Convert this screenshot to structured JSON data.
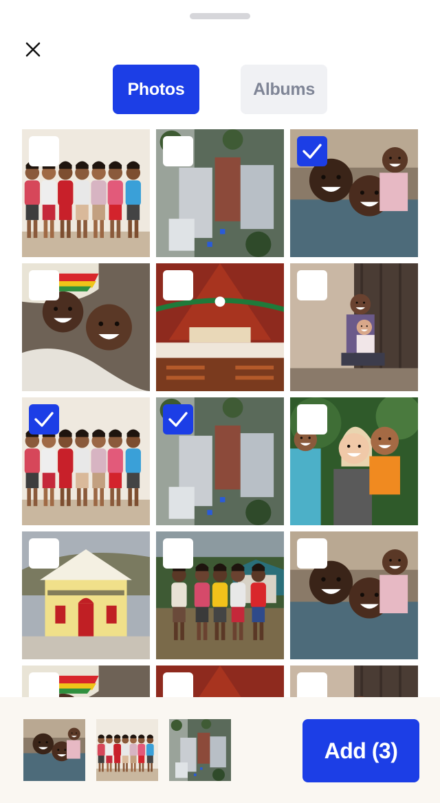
{
  "tabs": [
    {
      "label": "Photos",
      "active": true
    },
    {
      "label": "Albums",
      "active": false
    }
  ],
  "colors": {
    "accent": "#1c3ee6",
    "inactive_tab_bg": "#f0f1f4",
    "inactive_tab_text": "#7f8596",
    "bottom_bar_bg": "#faf7f2"
  },
  "icons": {
    "close": "close-icon",
    "check": "checkmark-icon"
  },
  "grid": {
    "photos": [
      {
        "scene": "children-wall",
        "selected": false
      },
      {
        "scene": "aerial-rooftops",
        "selected": false
      },
      {
        "scene": "kids-smiling",
        "selected": true
      },
      {
        "scene": "mother-child",
        "selected": false
      },
      {
        "scene": "church-interior",
        "selected": false
      },
      {
        "scene": "woman-baby-door",
        "selected": false
      },
      {
        "scene": "children-wall",
        "selected": true
      },
      {
        "scene": "aerial-rooftops",
        "selected": true
      },
      {
        "scene": "girl-boy-hug",
        "selected": false
      },
      {
        "scene": "yellow-church",
        "selected": false
      },
      {
        "scene": "kids-running",
        "selected": false
      },
      {
        "scene": "kids-smiling",
        "selected": false
      },
      {
        "scene": "mother-child",
        "selected": false
      },
      {
        "scene": "church-interior",
        "selected": false
      },
      {
        "scene": "woman-baby-door",
        "selected": false
      }
    ]
  },
  "selected_thumbnails": [
    "kids-smiling",
    "children-wall",
    "aerial-rooftops"
  ],
  "add_button": {
    "label": "Add (3)"
  }
}
